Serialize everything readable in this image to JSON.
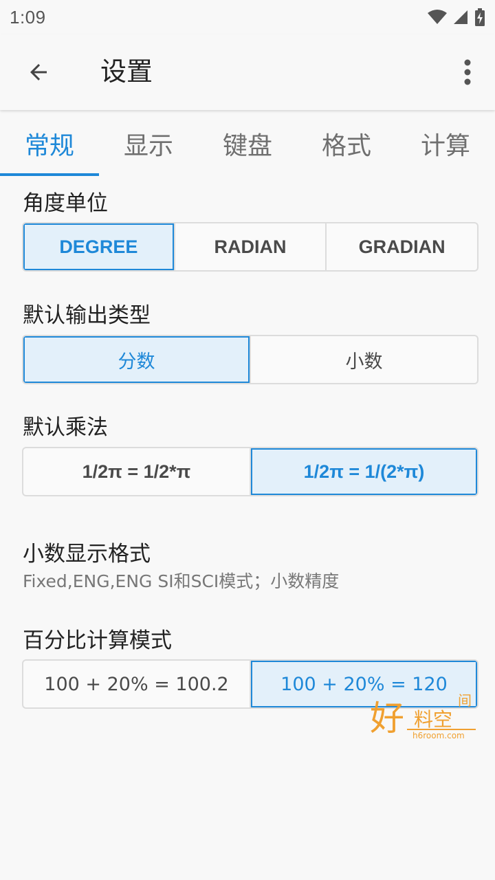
{
  "status_bar": {
    "time": "1:09"
  },
  "app_bar": {
    "title": "设置"
  },
  "tabs": [
    {
      "label": "常规",
      "active": true
    },
    {
      "label": "显示",
      "active": false
    },
    {
      "label": "键盘",
      "active": false
    },
    {
      "label": "格式",
      "active": false
    },
    {
      "label": "计算",
      "active": false
    }
  ],
  "angle_unit": {
    "label": "角度单位",
    "options": [
      "DEGREE",
      "RADIAN",
      "GRADIAN"
    ],
    "selected": "DEGREE"
  },
  "output_type": {
    "label": "默认输出类型",
    "options": [
      "分数",
      "小数"
    ],
    "selected": "分数"
  },
  "multiplication": {
    "label": "默认乘法",
    "options": [
      "1/2π = 1/2*π",
      "1/2π = 1/(2*π)"
    ],
    "selected": "1/2π = 1/(2*π)"
  },
  "decimal_format": {
    "label": "小数显示格式",
    "subtitle": "Fixed,ENG,ENG SI和SCI模式；小数精度"
  },
  "percent_mode": {
    "label": "百分比计算模式",
    "options": [
      "100 + 20% = 100.2",
      "100 + 20% = 120"
    ],
    "selected": "100 + 20% = 120"
  },
  "watermark": {
    "main": "好料空",
    "corner": "间",
    "url": "h6room.com"
  },
  "colors": {
    "accent": "#1e88d8",
    "selected_bg": "#e3f0fa",
    "watermark": "#f0a030"
  }
}
